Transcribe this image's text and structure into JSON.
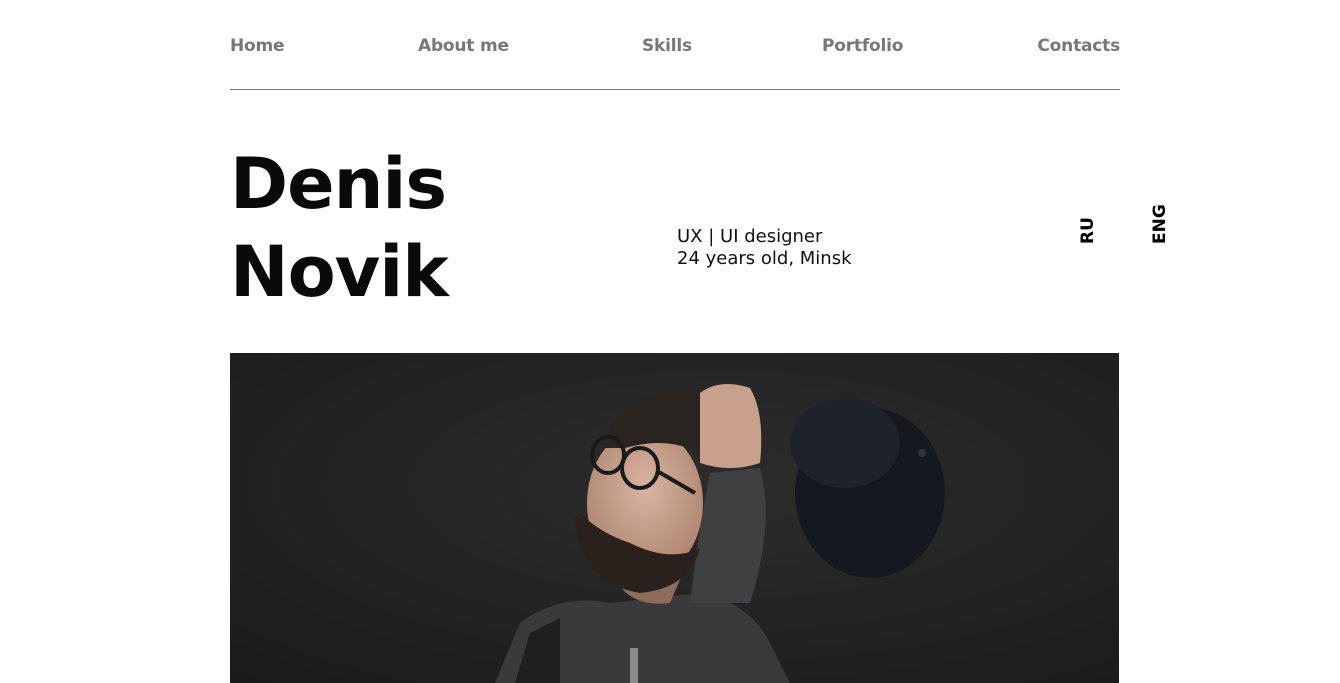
{
  "nav": {
    "items": [
      {
        "label": "Home"
      },
      {
        "label": "About me"
      },
      {
        "label": "Skills"
      },
      {
        "label": "Portfolio"
      },
      {
        "label": "Contacts"
      }
    ]
  },
  "hero": {
    "first_name": "Denis",
    "last_name": "Novik",
    "role": "UX | UI designer",
    "details": "24 years old, Minsk"
  },
  "languages": {
    "ru": "RU",
    "eng": "ENG"
  },
  "colors": {
    "nav_text": "#777777",
    "heading": "#0a0a0a",
    "photo_bg": "#232323"
  }
}
